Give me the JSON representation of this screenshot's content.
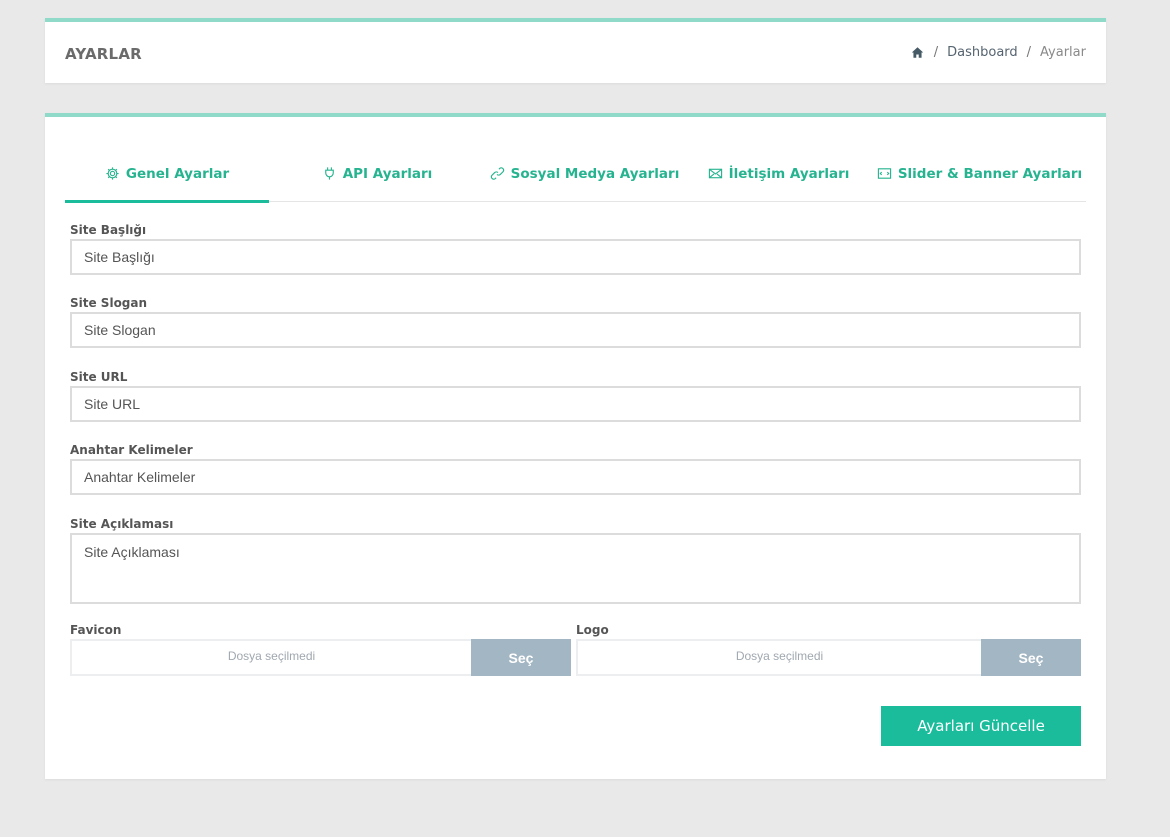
{
  "header": {
    "title": "AYARLAR",
    "breadcrumb": {
      "home_icon": "home-icon",
      "separator": "/",
      "items": [
        "Dashboard",
        "Ayarlar"
      ]
    }
  },
  "tabs": [
    {
      "label": "Genel Ayarlar",
      "icon": "gear-icon",
      "active": true
    },
    {
      "label": "API Ayarları",
      "icon": "plug-icon",
      "active": false
    },
    {
      "label": "Sosyal Medya Ayarları",
      "icon": "link-icon",
      "active": false
    },
    {
      "label": "İletişim Ayarları",
      "icon": "envelope-icon",
      "active": false
    },
    {
      "label": "Slider & Banner Ayarları",
      "icon": "slider-icon",
      "active": false
    }
  ],
  "form": {
    "site_title": {
      "label": "Site Başlığı",
      "placeholder": "Site Başlığı"
    },
    "site_slogan": {
      "label": "Site Slogan",
      "placeholder": "Site Slogan"
    },
    "site_url": {
      "label": "Site URL",
      "placeholder": "Site URL"
    },
    "keywords": {
      "label": "Anahtar Kelimeler",
      "placeholder": "Anahtar Kelimeler"
    },
    "description": {
      "label": "Site Açıklaması",
      "placeholder": "Site Açıklaması"
    },
    "favicon": {
      "label": "Favicon",
      "file_status": "Dosya seçilmedi",
      "button": "Seç"
    },
    "logo": {
      "label": "Logo",
      "file_status": "Dosya seçilmedi",
      "button": "Seç"
    },
    "submit_label": "Ayarları Güncelle"
  },
  "colors": {
    "accent": "#1abc9c",
    "card_border": "#8fdac8",
    "file_button": "#a3b6c3"
  }
}
